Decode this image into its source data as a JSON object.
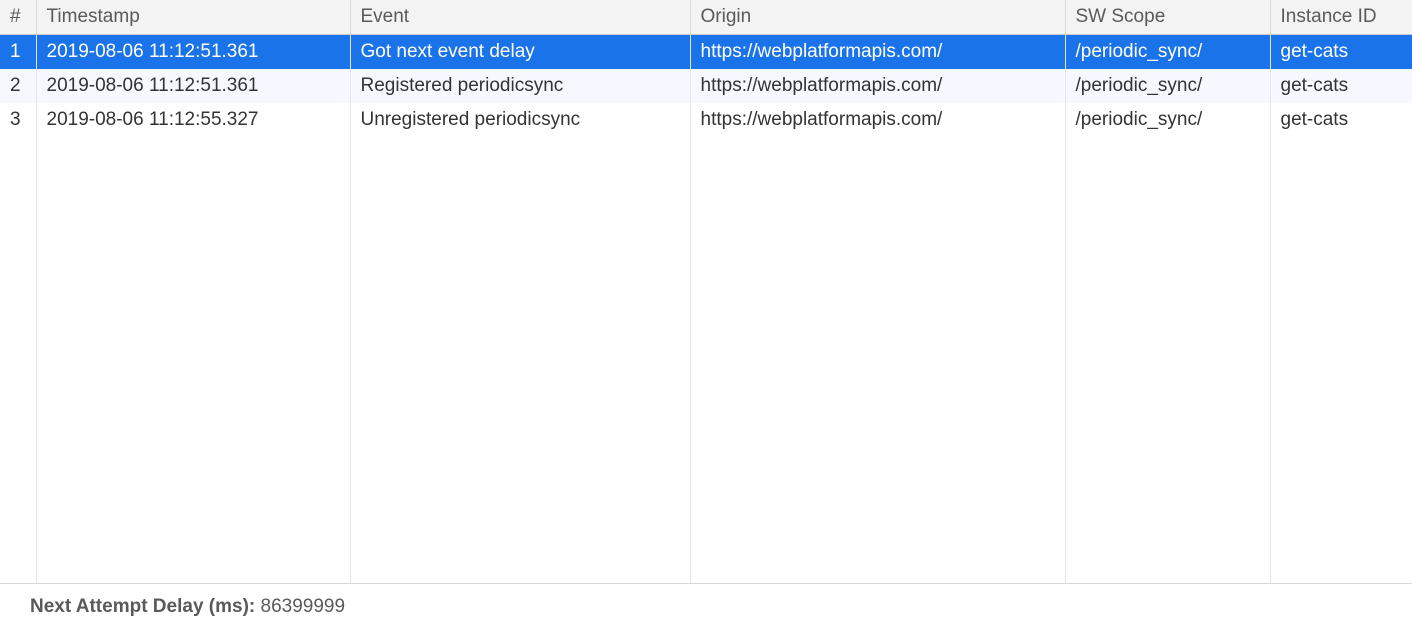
{
  "table": {
    "headers": {
      "num": "#",
      "timestamp": "Timestamp",
      "event": "Event",
      "origin": "Origin",
      "sw_scope": "SW Scope",
      "instance_id": "Instance ID"
    },
    "rows": [
      {
        "num": "1",
        "timestamp": "2019-08-06 11:12:51.361",
        "event": "Got next event delay",
        "origin": "https://webplatformapis.com/",
        "sw_scope": "/periodic_sync/",
        "instance_id": "get-cats",
        "selected": true
      },
      {
        "num": "2",
        "timestamp": "2019-08-06 11:12:51.361",
        "event": "Registered periodicsync",
        "origin": "https://webplatformapis.com/",
        "sw_scope": "/periodic_sync/",
        "instance_id": "get-cats",
        "selected": false
      },
      {
        "num": "3",
        "timestamp": "2019-08-06 11:12:55.327",
        "event": "Unregistered periodicsync",
        "origin": "https://webplatformapis.com/",
        "sw_scope": "/periodic_sync/",
        "instance_id": "get-cats",
        "selected": false
      }
    ]
  },
  "footer": {
    "label": "Next Attempt Delay (ms): ",
    "value": "86399999"
  }
}
